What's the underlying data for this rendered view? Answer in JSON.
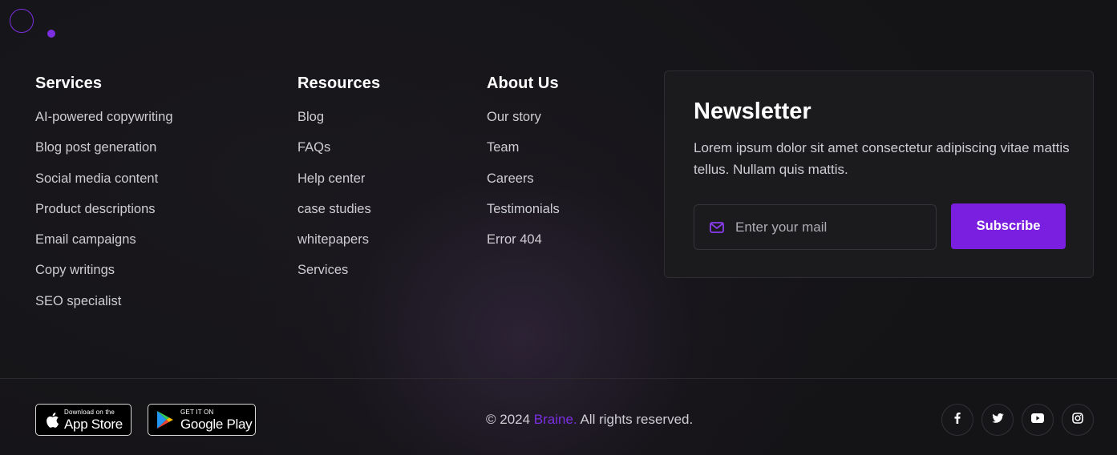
{
  "services": {
    "heading": "Services",
    "items": [
      "AI-powered copywriting",
      "Blog post generation",
      "Social media content",
      "Product descriptions",
      "Email campaigns",
      "Copy writings",
      "SEO specialist"
    ]
  },
  "resources": {
    "heading": "Resources",
    "items": [
      "Blog",
      "FAQs",
      "Help center",
      "case studies",
      "whitepapers",
      "Services"
    ]
  },
  "about": {
    "heading": "About Us",
    "items": [
      "Our story",
      "Team",
      "Careers",
      "Testimonials",
      "Error 404"
    ]
  },
  "newsletter": {
    "title": "Newsletter",
    "description": "Lorem ipsum dolor sit amet consectetur adipiscing vitae mattis tellus. Nullam quis mattis.",
    "email_placeholder": "Enter your mail",
    "email_value": "",
    "email_icon": "mail-icon",
    "subscribe_label": "Subscribe"
  },
  "badges": {
    "apple": {
      "small": "Download on the",
      "big": "App Store",
      "icon": "apple-icon"
    },
    "google": {
      "small": "GET IT ON",
      "big": "Google Play",
      "icon": "google-play-icon"
    }
  },
  "copyright": {
    "prefix": "© 2024 ",
    "brand": "Braine.",
    "suffix": " All rights reserved."
  },
  "social": [
    "facebook-icon",
    "twitter-icon",
    "youtube-icon",
    "instagram-icon"
  ],
  "colors": {
    "accent": "#7a1fe0",
    "background": "#141316",
    "card": "#1b1b1d",
    "heading": "#ffffff",
    "text": "#cfcdd4"
  }
}
